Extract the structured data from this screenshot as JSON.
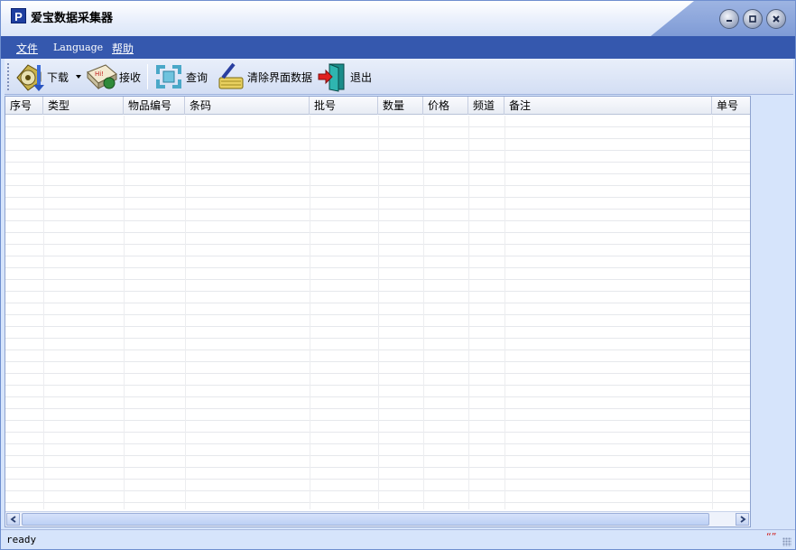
{
  "window": {
    "title": "爱宝数据采集器",
    "logo_letter": "P"
  },
  "menu": {
    "items": [
      {
        "label": "文件"
      },
      {
        "label": "Language"
      },
      {
        "label": "帮助"
      }
    ]
  },
  "toolbar": {
    "download_label": "下载",
    "receive_label": "接收",
    "query_label": "查询",
    "clear_label": "清除界面数据",
    "exit_label": "退出"
  },
  "grid": {
    "columns": [
      {
        "label": "序号"
      },
      {
        "label": "类型"
      },
      {
        "label": "物品编号"
      },
      {
        "label": "条码"
      },
      {
        "label": "批号"
      },
      {
        "label": "数量"
      },
      {
        "label": "价格"
      },
      {
        "label": "频道"
      },
      {
        "label": "备注"
      },
      {
        "label": "单号"
      }
    ],
    "rows": []
  },
  "status": {
    "text": "ready",
    "mark": "“”"
  },
  "colors": {
    "menubar": "#3558ae",
    "window_bg": "#d6e4fb"
  }
}
